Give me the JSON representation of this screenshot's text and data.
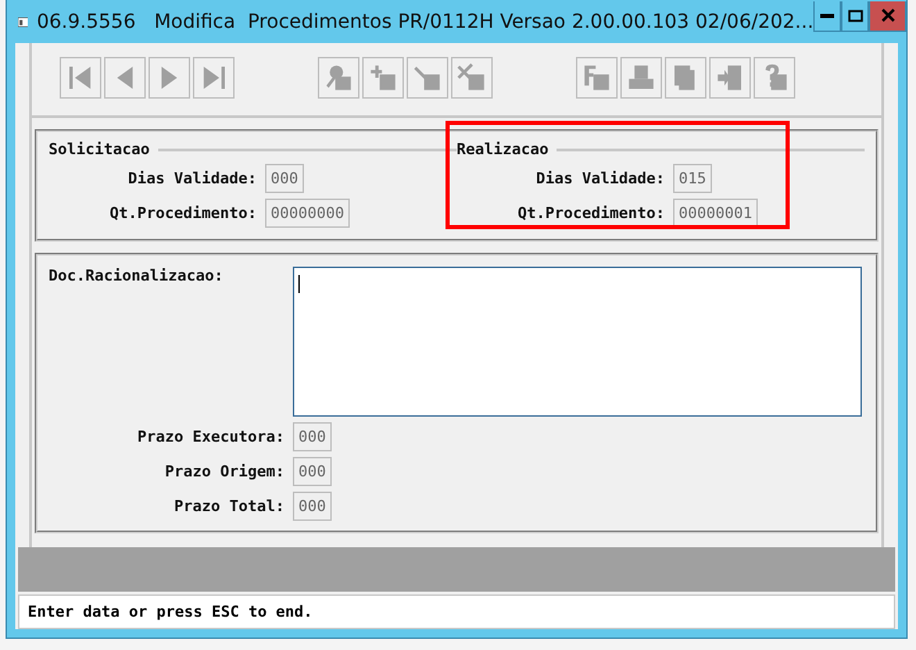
{
  "window": {
    "title": "06.9.5556   Modifica  Procedimentos PR/0112H Versao 2.00.00.103 02/06/202..."
  },
  "toolbar": [
    [
      {
        "kind": "first",
        "disabled": true
      },
      {
        "kind": "prev",
        "disabled": true
      },
      {
        "kind": "next",
        "disabled": true
      },
      {
        "kind": "last",
        "disabled": true
      }
    ],
    [
      {
        "kind": "search",
        "disabled": true
      },
      {
        "kind": "add",
        "disabled": true
      },
      {
        "kind": "edit",
        "disabled": true
      },
      {
        "kind": "delete",
        "disabled": true
      }
    ],
    [
      {
        "kind": "filter",
        "disabled": true
      },
      {
        "kind": "print",
        "disabled": true
      },
      {
        "kind": "copy",
        "disabled": true
      },
      {
        "kind": "exit",
        "disabled": true
      },
      {
        "kind": "help",
        "disabled": true
      }
    ]
  ],
  "groups": [
    {
      "title": "Solicitacao",
      "highlighted": false,
      "fields": [
        {
          "label": "Dias Validade:",
          "value": "000"
        },
        {
          "label": "Qt.Procedimento:",
          "value": "00000000"
        }
      ]
    },
    {
      "title": "Realizacao",
      "highlighted": true,
      "fields": [
        {
          "label": "Dias Validade:",
          "value": "015"
        },
        {
          "label": "Qt.Procedimento:",
          "value": "00000001"
        }
      ]
    }
  ],
  "doc": {
    "label": "Doc.Racionalizacao:"
  },
  "prazos": [
    {
      "label": "Prazo Executora:",
      "value": "000"
    },
    {
      "label": "Prazo Origem:",
      "value": "000"
    },
    {
      "label": "Prazo Total:",
      "value": "000"
    }
  ],
  "status_bar": "Enter data or press ESC to end."
}
